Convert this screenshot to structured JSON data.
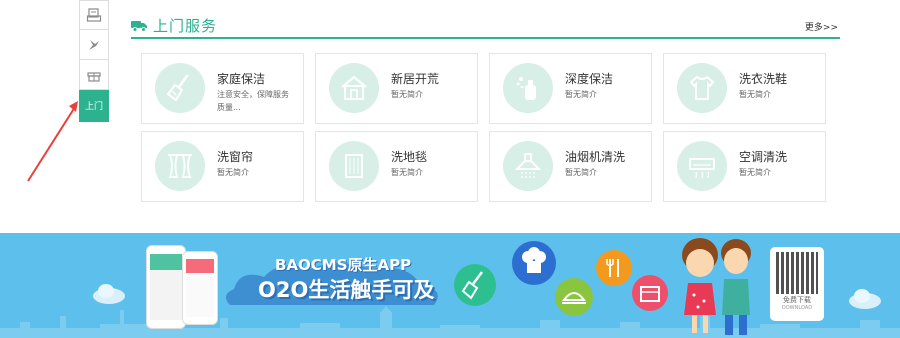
{
  "sidebar": {
    "tabs": [
      {
        "icon": "printer-icon"
      },
      {
        "icon": "bird-icon"
      },
      {
        "icon": "gift-icon"
      },
      {
        "label": "上门",
        "icon": ""
      }
    ]
  },
  "section": {
    "title": "上门服务",
    "more": "更多>>",
    "icon": "truck-icon"
  },
  "services": [
    {
      "name": "家庭保洁",
      "desc": "注意安全，保障服务质量...",
      "icon": "broom-icon"
    },
    {
      "name": "新居开荒",
      "desc": "暂无简介",
      "icon": "house-icon"
    },
    {
      "name": "深度保洁",
      "desc": "暂无简介",
      "icon": "spray-bottle-icon"
    },
    {
      "name": "洗衣洗鞋",
      "desc": "暂无简介",
      "icon": "shirt-icon"
    },
    {
      "name": "洗窗帘",
      "desc": "暂无简介",
      "icon": "curtain-icon"
    },
    {
      "name": "洗地毯",
      "desc": "暂无简介",
      "icon": "carpet-icon"
    },
    {
      "name": "油烟机清洗",
      "desc": "暂无简介",
      "icon": "range-hood-icon"
    },
    {
      "name": "空调清洗",
      "desc": "暂无简介",
      "icon": "air-conditioner-icon"
    }
  ],
  "banner": {
    "slogan_top": "BAOCMS原生APP",
    "slogan_main": "O2O生活触手可及",
    "qr_label": "免费下载",
    "qr_sub": "DOWNLOAD"
  },
  "colors": {
    "accent": "#2cb28f",
    "banner_bg": "#5dc0ec",
    "arrow": "#e8413b"
  }
}
